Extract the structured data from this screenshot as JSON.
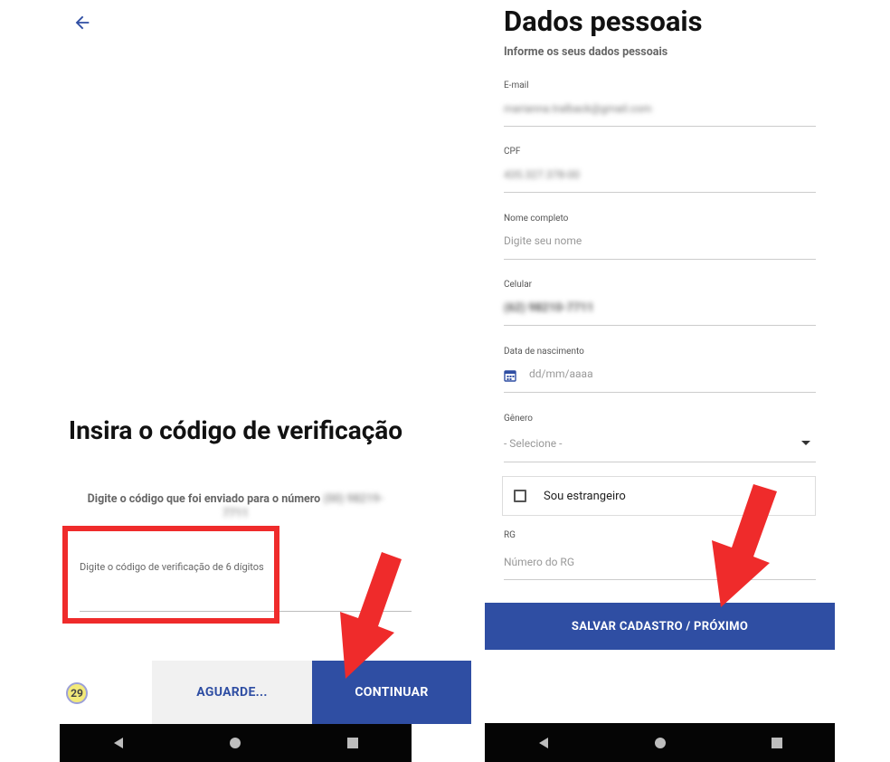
{
  "verification_screen": {
    "title": "Insira o código de verificação",
    "description": "Digite o código que foi enviado para o número",
    "masked_phone": "(00) 98219-7711",
    "code_input_label": "Digite o código de verificação de 6 dígitos",
    "timer_value": "29",
    "wait_label": "AGUARDE...",
    "continue_label": "CONTINUAR"
  },
  "personal_data_screen": {
    "title": "Dados pessoais",
    "subtitle": "Informe os seus dados pessoais",
    "email": {
      "label": "E-mail",
      "value": "marianna.tralback@gmail.com"
    },
    "cpf": {
      "label": "CPF",
      "value": "435.327.378-00"
    },
    "full_name": {
      "label": "Nome completo",
      "placeholder": "Digite seu nome"
    },
    "mobile": {
      "label": "Celular",
      "value": "(62) 98210-7711"
    },
    "birth_date": {
      "label": "Data de nascimento",
      "placeholder": "dd/mm/aaaa"
    },
    "gender": {
      "label": "Gênero",
      "selected": "- Selecione -"
    },
    "foreigner_checkbox": {
      "label": "Sou estrangeiro",
      "checked": false
    },
    "rg": {
      "label": "RG",
      "placeholder": "Número do RG"
    },
    "save_button_label": "SALVAR CADASTRO / PRÓXIMO"
  },
  "colors": {
    "brand_blue": "#2f4ea3",
    "highlight_red": "#ef2b2b",
    "nav_bar": "#050505"
  },
  "icons": [
    "back-arrow-icon",
    "calendar-icon",
    "dropdown-arrow-icon",
    "nav-back-icon",
    "nav-home-icon",
    "nav-recents-icon"
  ]
}
